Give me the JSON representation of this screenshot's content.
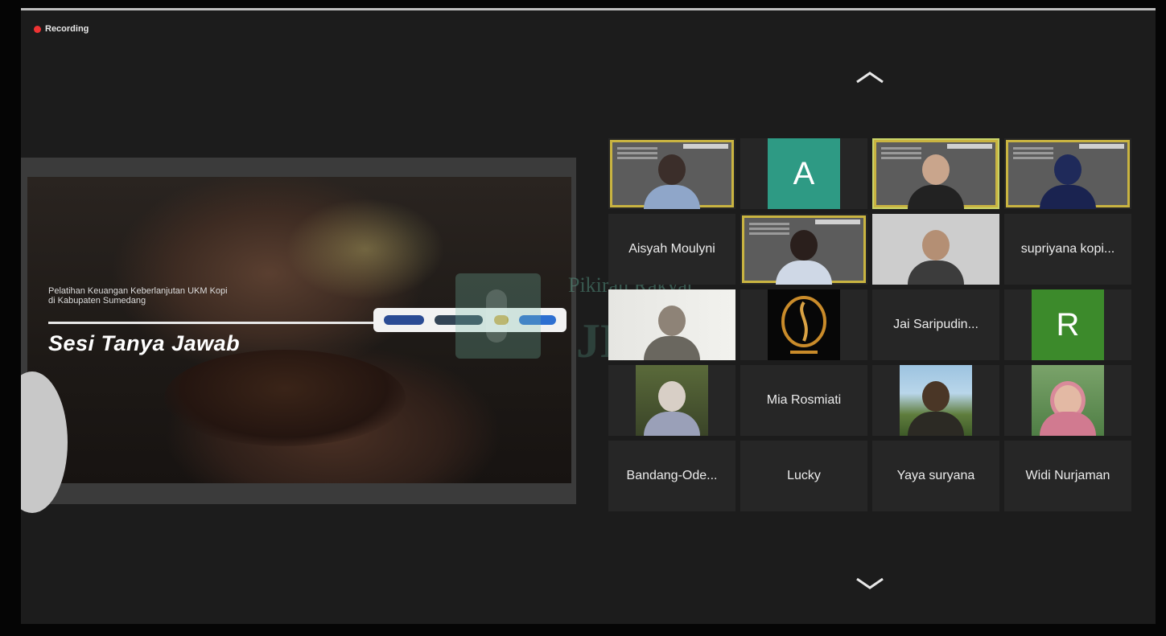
{
  "recording": {
    "label": "Recording"
  },
  "slide": {
    "subtitle": "Pelatihan Keuangan Keberlanjutan UKM Kopi\ndi Kabupaten Sumedang",
    "title": "Sesi Tanya Jawab"
  },
  "watermark": {
    "text": "Pikiran Rakyat",
    "big": "JN"
  },
  "gallery": {
    "tiles": [
      {
        "type": "video",
        "name": ""
      },
      {
        "type": "letter",
        "letter": "A",
        "color": "#2e9a84"
      },
      {
        "type": "video",
        "name": "",
        "active": true
      },
      {
        "type": "video",
        "name": ""
      },
      {
        "type": "name",
        "name": "Aisyah Moulyni"
      },
      {
        "type": "video",
        "name": ""
      },
      {
        "type": "video",
        "name": ""
      },
      {
        "type": "name",
        "name": "supriyana kopi..."
      },
      {
        "type": "video",
        "name": ""
      },
      {
        "type": "video",
        "name": ""
      },
      {
        "type": "name",
        "name": "Jai Saripudin..."
      },
      {
        "type": "letter",
        "letter": "R",
        "color": "#3c8a2b"
      },
      {
        "type": "video",
        "name": ""
      },
      {
        "type": "name",
        "name": "Mia Rosmiati"
      },
      {
        "type": "video",
        "name": ""
      },
      {
        "type": "video",
        "name": ""
      },
      {
        "type": "name",
        "name": "Bandang-Ode..."
      },
      {
        "type": "name",
        "name": "Lucky"
      },
      {
        "type": "name",
        "name": "Yaya suryana"
      },
      {
        "type": "name",
        "name": "Widi Nurjaman"
      }
    ]
  },
  "icons": {
    "up": "chevron-up-icon",
    "down": "chevron-down-icon",
    "recording": "recording-dot-icon"
  }
}
